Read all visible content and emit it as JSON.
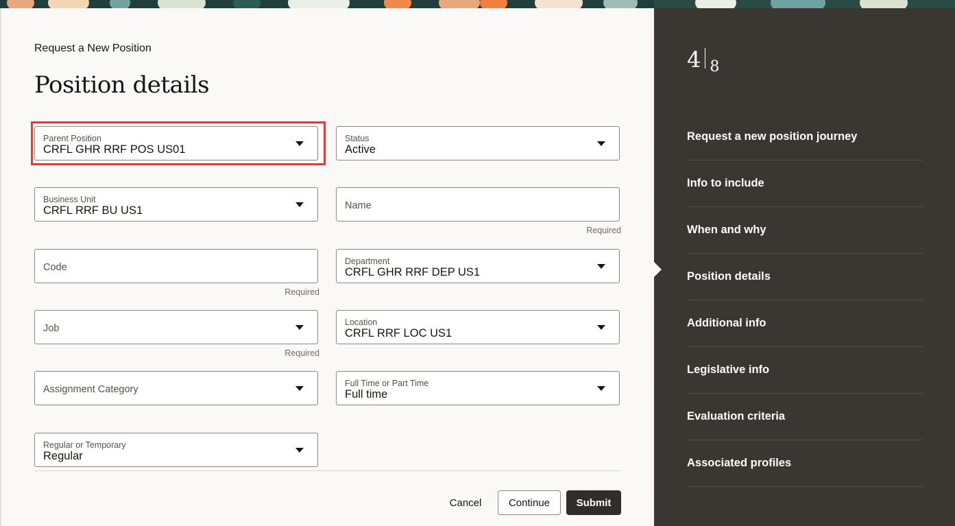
{
  "header": {
    "breadcrumb": "Request a New Position",
    "title": "Position details"
  },
  "fields": {
    "parent_position": {
      "label": "Parent Position",
      "value": "CRFL GHR RRF POS US01",
      "icon": "chevron-down-icon"
    },
    "status": {
      "label": "Status",
      "value": "Active",
      "icon": "chevron-down-icon"
    },
    "business_unit": {
      "label": "Business Unit",
      "value": "CRFL RRF BU US1",
      "icon": "chevron-down-icon"
    },
    "name": {
      "placeholder": "Name",
      "required": "Required"
    },
    "code": {
      "placeholder": "Code",
      "required": "Required"
    },
    "department": {
      "label": "Department",
      "value": "CRFL GHR RRF DEP US1",
      "icon": "chevron-down-icon"
    },
    "job": {
      "placeholder": "Job",
      "required": "Required",
      "icon": "chevron-down-icon"
    },
    "location": {
      "label": "Location",
      "value": "CRFL RRF LOC US1",
      "icon": "chevron-down-icon"
    },
    "assignment_category": {
      "placeholder": "Assignment Category",
      "icon": "chevron-down-icon"
    },
    "full_part_time": {
      "label": "Full Time or Part Time",
      "value": "Full time",
      "icon": "chevron-down-icon"
    },
    "regular_temporary": {
      "label": "Regular or Temporary",
      "value": "Regular",
      "icon": "chevron-down-icon"
    }
  },
  "actions": {
    "cancel": "Cancel",
    "continue": "Continue",
    "submit": "Submit"
  },
  "progress": {
    "current": "4",
    "total": "8"
  },
  "steps": [
    {
      "label": "Request a new position journey"
    },
    {
      "label": "Info to include"
    },
    {
      "label": "When and why"
    },
    {
      "label": "Position details"
    },
    {
      "label": "Additional info"
    },
    {
      "label": "Legislative info"
    },
    {
      "label": "Evaluation criteria"
    },
    {
      "label": "Associated profiles"
    }
  ],
  "colors": {
    "highlight": "#e0393e",
    "sidebar_bg": "#3a3631",
    "submit_bg": "#312d2a"
  }
}
